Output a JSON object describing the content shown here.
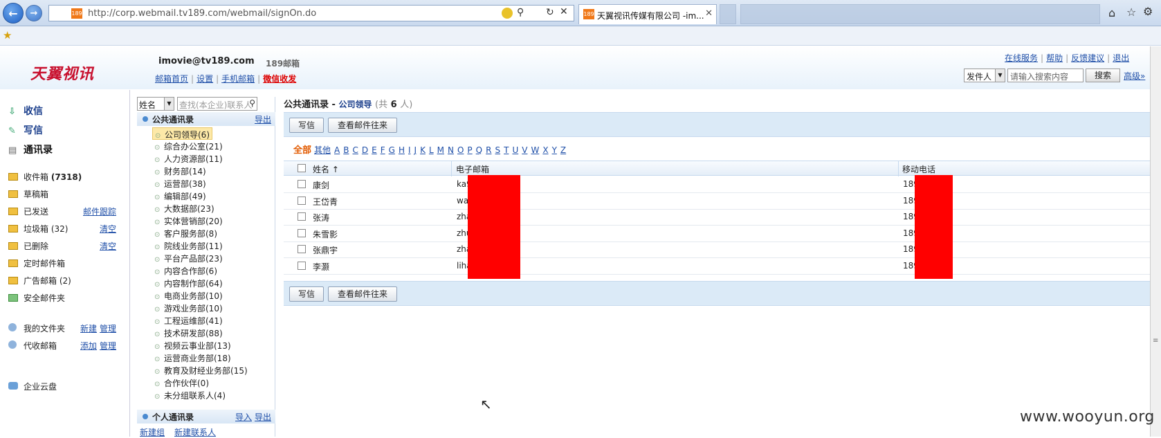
{
  "browser": {
    "url": "http://corp.webmail.tv189.com/webmail/signOn.do",
    "tab_title": "天翼视讯传媒有限公司 -im..."
  },
  "header": {
    "logo": "天翼视讯",
    "user_email": "imovie@tv189.com",
    "brand": "189邮箱",
    "links": [
      "邮箱首页",
      "设置",
      "手机邮箱",
      "微信收发"
    ],
    "top_right_links": [
      "在线服务",
      "帮助",
      "反馈建议",
      "退出"
    ],
    "search": {
      "type_value": "发件人",
      "placeholder": "请输入搜索内容",
      "button": "搜索",
      "advanced": "高级»"
    }
  },
  "leftnav": {
    "primary": [
      "收信",
      "写信",
      "通讯录"
    ],
    "folders": [
      {
        "label": "收件箱",
        "count": "(7318)"
      },
      {
        "label": "草稿箱"
      },
      {
        "label": "已发送",
        "action": "邮件跟踪"
      },
      {
        "label": "垃圾箱",
        "count": "(32)",
        "action": "清空"
      },
      {
        "label": "已删除",
        "action": "清空"
      },
      {
        "label": "定时邮件箱"
      },
      {
        "label": "广告邮箱",
        "count": "(2)"
      },
      {
        "label": "安全邮件夹"
      }
    ],
    "my_folders": {
      "label": "我的文件夹",
      "a1": "新建",
      "a2": "管理"
    },
    "proxy": {
      "label": "代收邮箱",
      "a1": "添加",
      "a2": "管理"
    },
    "cloud": "企业云盘"
  },
  "tree": {
    "search_field": "姓名",
    "search_placeholder": "查找(本企业)联系人",
    "public_section": "公共通讯录",
    "public_export": "导出",
    "groups": [
      "公司领导(6)",
      "综合办公室(21)",
      "人力资源部(11)",
      "财务部(14)",
      "运营部(38)",
      "编辑部(49)",
      "大数据部(23)",
      "实体营销部(20)",
      "客户服务部(8)",
      "院线业务部(11)",
      "平台产品部(23)",
      "内容合作部(6)",
      "内容制作部(64)",
      "电商业务部(10)",
      "游戏业务部(10)",
      "工程运维部(41)",
      "技术研发部(88)",
      "视频云事业部(13)",
      "运营商业务部(18)",
      "教育及财经业务部(15)",
      "合作伙伴(0)",
      "未分组联系人(4)"
    ],
    "personal_section": "个人通讯录",
    "personal_import": "导入",
    "personal_export": "导出",
    "new_group": "新建组",
    "new_contact": "新建联系人"
  },
  "main": {
    "title": "公共通讯录 -",
    "subtitle": "公司领导",
    "count_prefix": "(共",
    "count": "6",
    "count_suffix": "人)",
    "write_btn": "写信",
    "view_btn": "查看邮件往来",
    "alpha_all": "全部",
    "alpha": [
      "其他",
      "A",
      "B",
      "C",
      "D",
      "E",
      "F",
      "G",
      "H",
      "I",
      "J",
      "K",
      "L",
      "M",
      "N",
      "O",
      "P",
      "Q",
      "R",
      "S",
      "T",
      "U",
      "V",
      "W",
      "X",
      "Y",
      "Z"
    ],
    "columns": [
      "姓名 ↑",
      "电子邮箱",
      "移动电话"
    ],
    "rows": [
      {
        "name": "康剑",
        "email": "ka9.com",
        "phone": "18939"
      },
      {
        "name": "王岱青",
        "email": "wav189.com",
        "phone": "18926"
      },
      {
        "name": "张涛",
        "email": "zha9.com",
        "phone": "18939"
      },
      {
        "name": "朱雪影",
        "email": "zhu189.com",
        "phone": "18927"
      },
      {
        "name": "张鼎宇",
        "email": "zhav189.com",
        "phone": "18911"
      },
      {
        "name": "李灏",
        "email": "liham",
        "phone": "18939"
      }
    ]
  },
  "watermark": "www.wooyun.org"
}
